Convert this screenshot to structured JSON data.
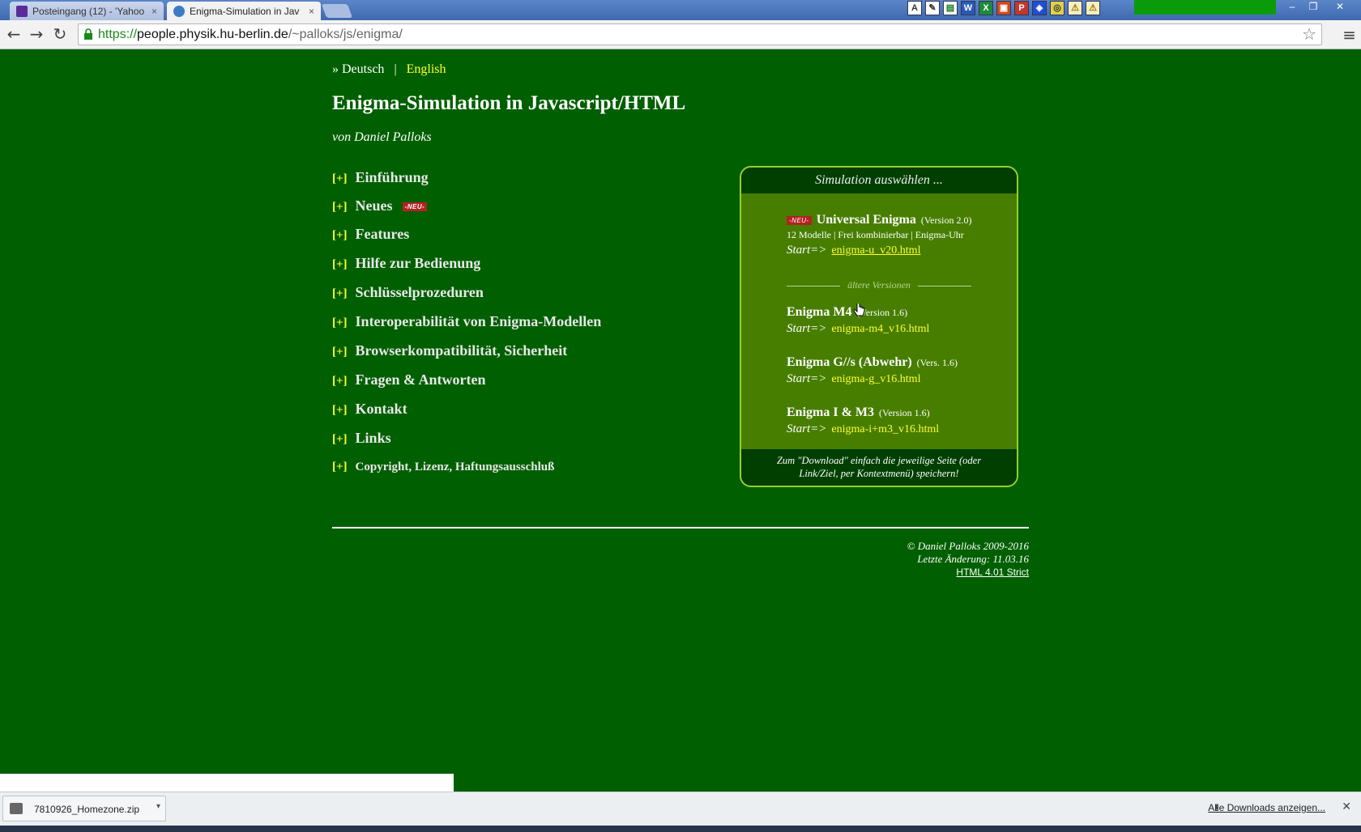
{
  "browser": {
    "tabs": [
      {
        "title": "Posteingang (12) - 'Yahoo",
        "close": "×",
        "favicon_color": "#5a2a9b"
      },
      {
        "title": "Enigma-Simulation in Jav",
        "close": "×",
        "favicon_color": "#3d7bc7"
      }
    ],
    "url": {
      "scheme": "https://",
      "host": "people.physik.hu-berlin.de",
      "path": "/~palloks/js/enigma/"
    },
    "nav": {
      "back": "←",
      "forward": "→",
      "reload": "↻",
      "star": "☆",
      "menu": "≡"
    },
    "window_controls": {
      "minimize": "–",
      "maximize": "❐",
      "close": "✕"
    },
    "ext_icons": [
      "A",
      "✎",
      "▤",
      "W",
      "X",
      "▣",
      "P",
      "◈",
      "◎",
      "⚠",
      "⚠"
    ]
  },
  "page": {
    "lang": {
      "prefix": "» Deutsch",
      "sep": "|",
      "english": "English"
    },
    "title": "Enigma-Simulation in Javascript/HTML",
    "author": "von Daniel Palloks",
    "plus": "[+]",
    "new_badge": "-NEU-",
    "menu": [
      "Einführung",
      "Neues",
      "Features",
      "Hilfe zur Bedienung",
      "Schlüsselprozeduren",
      "Interoperabilität von Enigma-Modellen",
      "Browserkompatibilität, Sicherheit",
      "Fragen & Antworten",
      "Kontakt",
      "Links",
      "Copyright, Lizenz, Haftungsausschluß"
    ],
    "sim": {
      "header": "Simulation auswählen ...",
      "start_label": "Start=>",
      "universal": {
        "name": "Universal Enigma",
        "version": "(Version 2.0)",
        "desc": "12 Modelle | Frei kombinierbar | Enigma-Uhr",
        "link": "enigma-u_v20.html"
      },
      "older_label": "ältere Versionen",
      "m4": {
        "name": "Enigma M4",
        "version": "(Version 1.6)",
        "link": "enigma-m4_v16.html"
      },
      "g": {
        "name": "Enigma G//s  (Abwehr)",
        "version": "(Vers. 1.6)",
        "link": "enigma-g_v16.html"
      },
      "i": {
        "name": "Enigma I & M3",
        "version": "(Version 1.6)",
        "link": "enigma-i+m3_v16.html"
      },
      "footer": "Zum \"Download\" einfach die jeweilige Seite (oder Link/Ziel, per Kontextmenü) speichern!"
    },
    "footer": {
      "copyright": "© Daniel Palloks 2009-2016",
      "updated": "Letzte Änderung: 11.03.16",
      "valid": "HTML 4.01 Strict"
    }
  },
  "downloads": {
    "file": "7810926_Homezone.zip",
    "arrow": "▾",
    "show_all": "Alle Downloads anzeigen...",
    "icon": "⭳",
    "close": "✕"
  }
}
